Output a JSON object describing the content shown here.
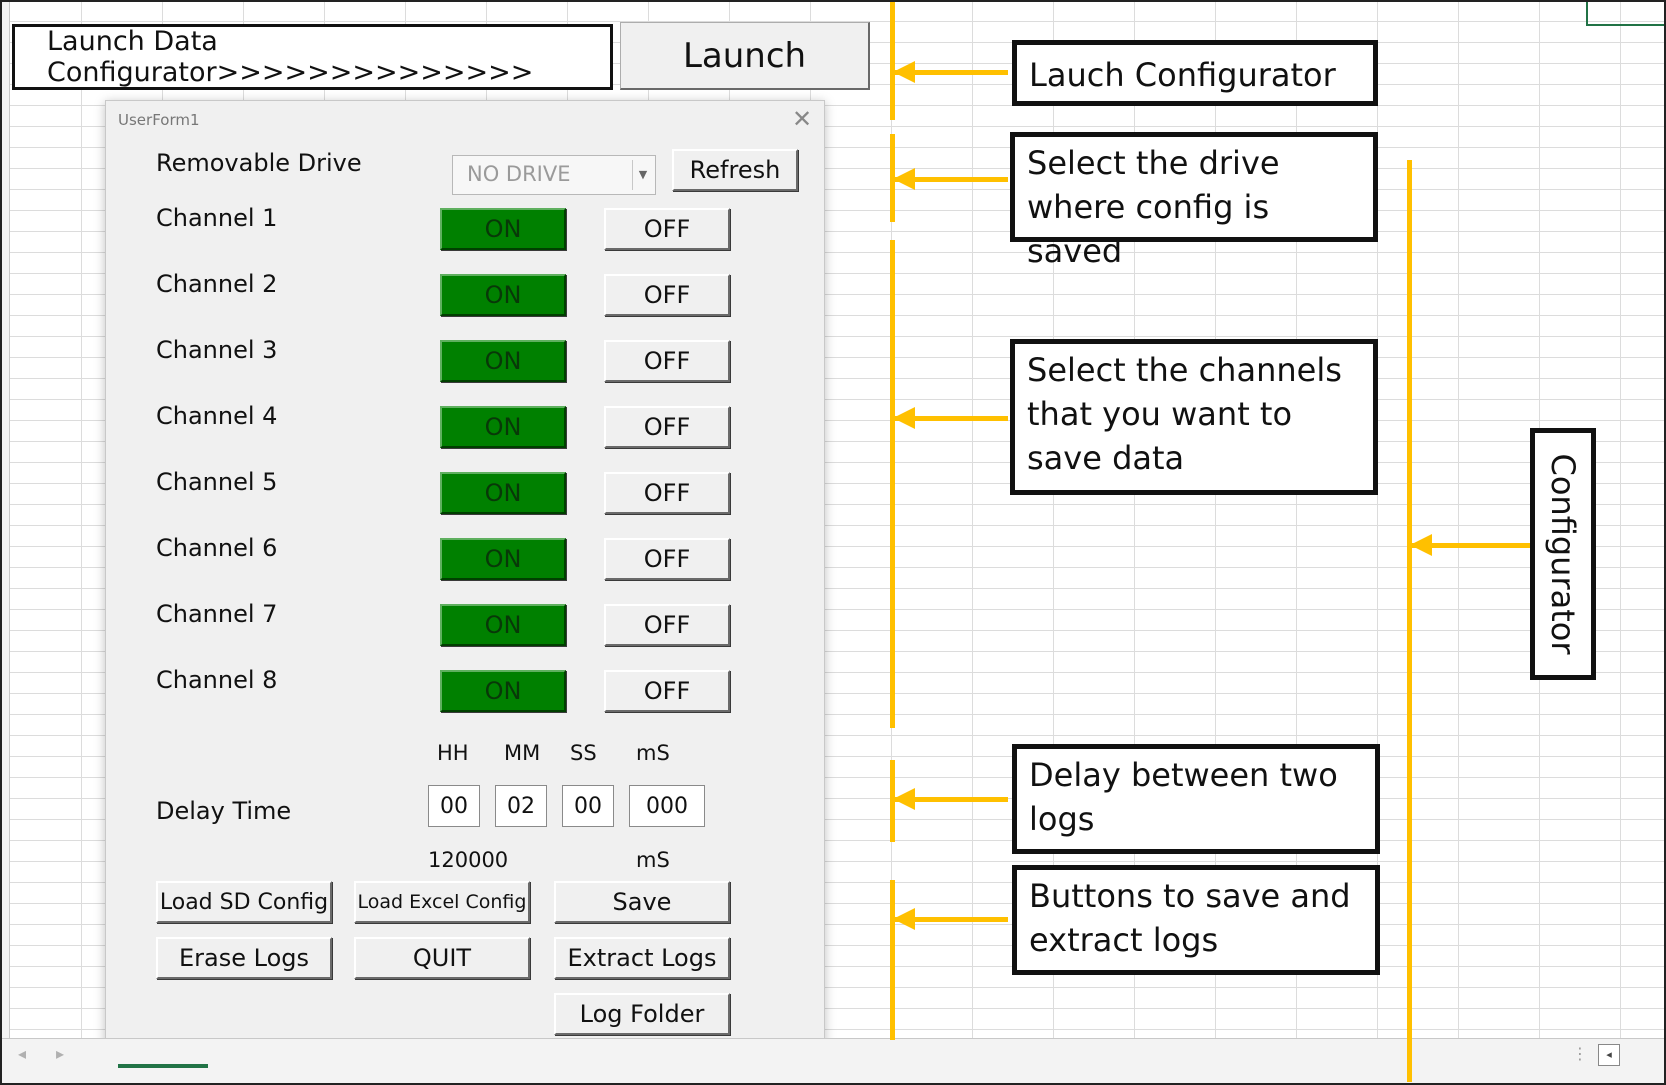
{
  "sheet": {
    "launch_label": "Launch Data Configurator>>>>>>>>>>>>>>",
    "launch_button": "Launch"
  },
  "form": {
    "title": "UserForm1",
    "close_glyph": "✕",
    "drive_label": "Removable Drive",
    "drive_value": "NO DRIVE",
    "refresh_label": "Refresh",
    "channels": [
      {
        "label": "Channel 1",
        "on": "ON",
        "off": "OFF"
      },
      {
        "label": "Channel 2",
        "on": "ON",
        "off": "OFF"
      },
      {
        "label": "Channel 3",
        "on": "ON",
        "off": "OFF"
      },
      {
        "label": "Channel 4",
        "on": "ON",
        "off": "OFF"
      },
      {
        "label": "Channel 5",
        "on": "ON",
        "off": "OFF"
      },
      {
        "label": "Channel 6",
        "on": "ON",
        "off": "OFF"
      },
      {
        "label": "Channel 7",
        "on": "ON",
        "off": "OFF"
      },
      {
        "label": "Channel 8",
        "on": "ON",
        "off": "OFF"
      }
    ],
    "time_headers": [
      "HH",
      "MM",
      "SS",
      "mS"
    ],
    "delay_label": "Delay Time",
    "delay_values": [
      "00",
      "02",
      "00",
      "000"
    ],
    "total_value": "120000",
    "total_unit": "mS",
    "buttons": {
      "load_sd": "Load SD Config",
      "load_excel": "Load Excel Config",
      "save": "Save",
      "erase": "Erase Logs",
      "quit": "QUIT",
      "extract": "Extract Logs",
      "log_folder": "Log Folder"
    }
  },
  "callouts": {
    "launch": "Lauch Configurator",
    "drive": "Select the drive where config is saved",
    "channels": "Select the channels that you want to save data",
    "delay": "Delay between two logs",
    "buttons": "Buttons to save and extract logs",
    "configurator": "Configurator"
  },
  "colors": {
    "on_button": "#008000",
    "annotation_line": "#ffc000",
    "selected_cell": "#217346"
  },
  "bottombar": {
    "nav_left": "◂",
    "nav_right": "▸",
    "more": "⋮",
    "scroll_left": "◂"
  }
}
